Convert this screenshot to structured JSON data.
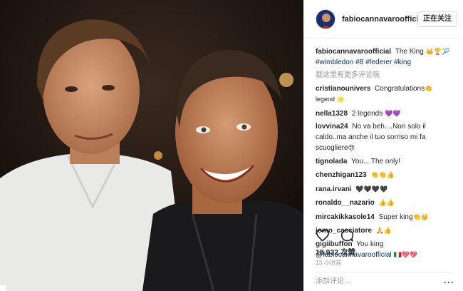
{
  "photo": {
    "alt_icon": "post-photo"
  },
  "header": {
    "username": "fabiocannavaroofficial",
    "follow_label": "正在关注"
  },
  "caption": {
    "username": "fabiocannavaroofficial",
    "text": "The King",
    "emojis": "👑🏆🎾",
    "tags": [
      "#wimbledon",
      "#8",
      "#federer",
      "#king"
    ]
  },
  "view_more": "载这里有更多评论哦",
  "comments": [
    {
      "user": "cristianounivers",
      "text": "Congratulations",
      "emoji": "👏legend 🌟"
    },
    {
      "user": "nella1328",
      "text": "2 legends",
      "emoji": "💜💜"
    },
    {
      "user": "lovvina24",
      "text": "No va beh....Non solo il caldo..ma anche il tuo sorriso mi fa scuogliere",
      "emoji": "😍"
    },
    {
      "user": "tignolada",
      "text": "You... The only!",
      "emoji": ""
    },
    {
      "user": "chenzhigan123",
      "text": "",
      "emoji": "👏👏👍"
    },
    {
      "user": "rana.irvani",
      "text": "",
      "emoji": "🖤🖤🖤🖤"
    },
    {
      "user": "ronaldo__nazario",
      "text": "",
      "emoji": "👍👍"
    },
    {
      "user": "mircakikkasole14",
      "text": "Super king",
      "emoji": "👏👑"
    },
    {
      "user": "jomo_cacciatore",
      "text": "",
      "emoji": "🙏👍"
    },
    {
      "user": "gigiibuffon",
      "text": "You king",
      "emoji": ""
    }
  ],
  "last_mention": {
    "text": "@fabiocannavaroofficial",
    "emoji": "🇮🇹💖💖"
  },
  "stats": {
    "likes": "18,932 次赞",
    "time": "13 小时前"
  },
  "add_comment": {
    "placeholder": "添加评论..."
  },
  "more_options": "···"
}
